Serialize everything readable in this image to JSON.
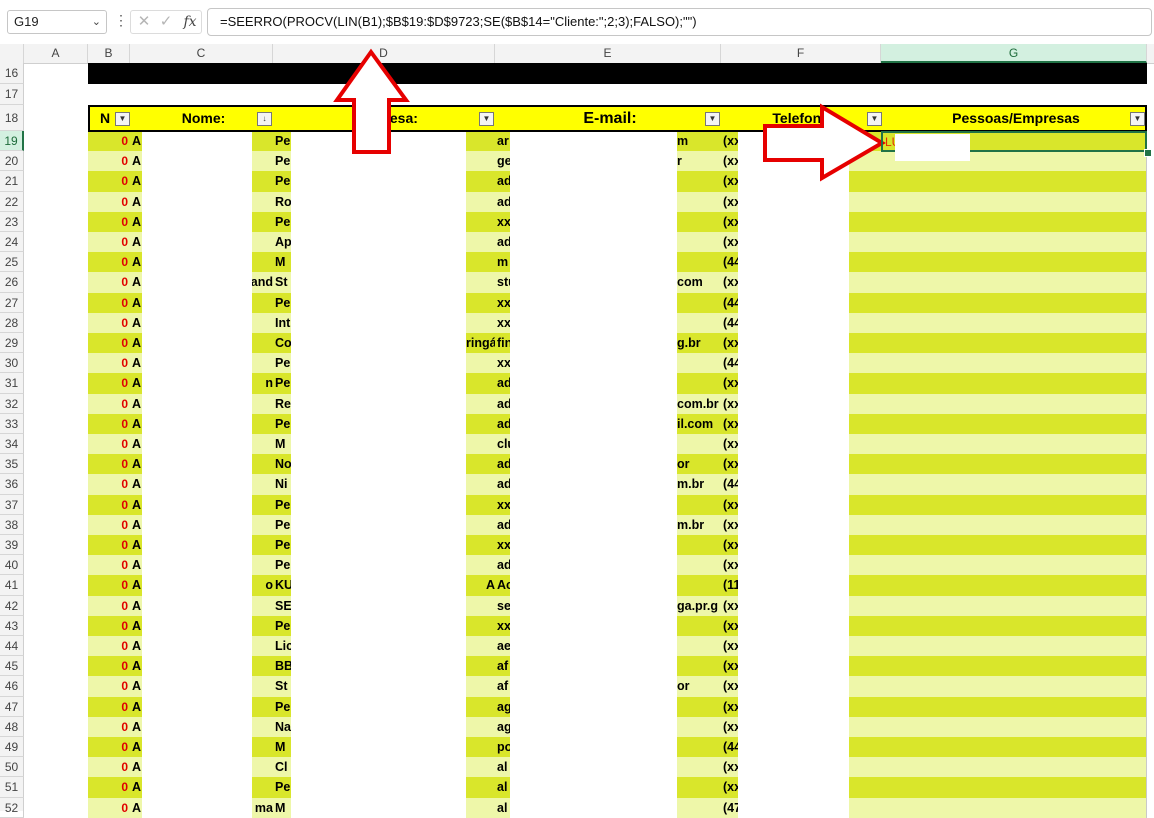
{
  "namebox": "G19",
  "formula_bar": {
    "fx_label": "fx",
    "cancel_glyph": "✕",
    "enter_glyph": "✓",
    "formula": "=SEERRO(PROCV(LIN(B1);$B$19:$D$9723;SE($B$14=\"Cliente:\";2;3);FALSO);\"\")"
  },
  "columns": [
    "A",
    "B",
    "C",
    "D",
    "E",
    "F",
    "G"
  ],
  "header": {
    "b": "N",
    "c": "Nome:",
    "d": "Empresa:",
    "e": "E-mail:",
    "f": "Telefone:",
    "g": "Pessoas/Empresas"
  },
  "row_numbers": [
    16,
    17,
    18,
    19,
    20,
    21,
    22,
    23,
    24,
    25,
    26,
    27,
    28,
    29,
    30,
    31,
    32,
    33,
    34,
    35,
    36,
    37,
    38,
    39,
    40,
    41,
    42,
    43,
    44,
    45,
    46,
    47,
    48,
    49,
    50,
    51,
    52
  ],
  "g19_value": "LU",
  "rows": [
    {
      "n": "0",
      "b": "A",
      "c2": "",
      "d": "Pe",
      "e": "ar",
      "e2": "m",
      "f": "(xx"
    },
    {
      "n": "0",
      "b": "A",
      "c2": "",
      "d": "Pe",
      "e": "ge",
      "e2": "r",
      "f": "(xx"
    },
    {
      "n": "0",
      "b": "A",
      "c2": "",
      "d": "Pe",
      "e": "ad",
      "e2": "",
      "f": "(xx"
    },
    {
      "n": "0",
      "b": "A",
      "c2": "",
      "d": "Ro",
      "e": "ad",
      "e2": "",
      "f": "(xx"
    },
    {
      "n": "0",
      "b": "A",
      "c2": "",
      "d": "Pe",
      "e": "xx",
      "e2": "",
      "f": "(xx"
    },
    {
      "n": "0",
      "b": "A",
      "c2": "",
      "d": "Ap",
      "e": "ad",
      "e2": "",
      "f": "(xx"
    },
    {
      "n": "0",
      "b": "A",
      "c2": "",
      "d": "M",
      "e": "m",
      "e2": "",
      "f": "(44"
    },
    {
      "n": "0",
      "b": "A",
      "c2": "and",
      "d": "St",
      "e": "stu",
      "e2": "com",
      "f": "(xx"
    },
    {
      "n": "0",
      "b": "A",
      "c2": "",
      "d": "Pe",
      "e": "xx",
      "e2": "",
      "f": "(44"
    },
    {
      "n": "0",
      "b": "A",
      "c2": "",
      "d": "Int",
      "e": "xx",
      "e2": "",
      "f": "(44"
    },
    {
      "n": "0",
      "b": "A",
      "c2": "",
      "d": "Co",
      "d2": "ringá",
      "e": "fin",
      "e2": "g.br",
      "f": "(xx"
    },
    {
      "n": "0",
      "b": "A",
      "c2": "",
      "d": "Pe",
      "e": "xx",
      "e2": "",
      "f": "(44"
    },
    {
      "n": "0",
      "b": "A",
      "c2": "n",
      "d": "Pe",
      "e": "ad",
      "e2": "",
      "f": "(xx"
    },
    {
      "n": "0",
      "b": "A",
      "c2": "",
      "d": "Re",
      "e": "ad",
      "e2": "com.br",
      "f": "(xx"
    },
    {
      "n": "0",
      "b": "A",
      "c2": "",
      "d": "Pe",
      "e": "ad",
      "e2": "il.com",
      "f": "(xx"
    },
    {
      "n": "0",
      "b": "A",
      "c2": "",
      "d": "M",
      "e": "clu",
      "e2": "",
      "f": "(xx"
    },
    {
      "n": "0",
      "b": "A",
      "c2": "",
      "d": "No",
      "e": "ad",
      "e2": "or",
      "f": "(xx"
    },
    {
      "n": "0",
      "b": "A",
      "c2": "",
      "d": "Ni",
      "e": "ad",
      "e2": "m.br",
      "f": "(44"
    },
    {
      "n": "0",
      "b": "A",
      "c2": "",
      "d": "Pe",
      "e": "xx",
      "e2": "",
      "f": "(xx"
    },
    {
      "n": "0",
      "b": "A",
      "c2": "",
      "d": "Pe",
      "e": "ad",
      "e2": "m.br",
      "f": "(xx"
    },
    {
      "n": "0",
      "b": "A",
      "c2": "",
      "d": "Pe",
      "e": "xx",
      "e2": "",
      "f": "(xx"
    },
    {
      "n": "0",
      "b": "A",
      "c2": "",
      "d": "Pe",
      "e": "ad",
      "e2": "",
      "f": "(xx"
    },
    {
      "n": "0",
      "b": "A",
      "c2": "o",
      "d": "KU",
      "d2": "A",
      "e": "Ac",
      "e2": "",
      "f": "(11"
    },
    {
      "n": "0",
      "b": "A",
      "c2": "",
      "d": "SE",
      "e": "se",
      "e2": "ga.pr.g",
      "f": "(xx"
    },
    {
      "n": "0",
      "b": "A",
      "c2": "",
      "d": "Pe",
      "e": "xx",
      "e2": "",
      "f": "(xx"
    },
    {
      "n": "0",
      "b": "A",
      "c2": "",
      "d": "Lic",
      "e": "ae",
      "e2": "",
      "f": "(xx"
    },
    {
      "n": "0",
      "b": "A",
      "c2": "",
      "d": "BB",
      "e": "af",
      "e2": "",
      "f": "(xx"
    },
    {
      "n": "0",
      "b": "A",
      "c2": "",
      "d": "St",
      "e": "af",
      "e2": "or",
      "f": "(xx"
    },
    {
      "n": "0",
      "b": "A",
      "c2": "",
      "d": "Pe",
      "e": "ag",
      "e2": "",
      "f": "(xx"
    },
    {
      "n": "0",
      "b": "A",
      "c2": "",
      "d": "Na",
      "e": "ag",
      "e2": "",
      "f": "(xx"
    },
    {
      "n": "0",
      "b": "A",
      "c2": "",
      "d": "M",
      "e": "po",
      "e2": "",
      "f": "(44"
    },
    {
      "n": "0",
      "b": "A",
      "c2": "",
      "d": "Cl",
      "e": "al",
      "e2": "",
      "f": "(xx"
    },
    {
      "n": "0",
      "b": "A",
      "c2": "",
      "d": "Pe",
      "e": "al",
      "e2": "",
      "f": "(xx"
    },
    {
      "n": "0",
      "b": "A",
      "c2": "ma",
      "d": "M",
      "e": "al",
      "e2": "",
      "f": "(47"
    }
  ],
  "colors": {
    "header_yellow": "#ffff00",
    "row_dark": "#d9e62b",
    "row_light": "#eef7a9",
    "error_red": "#e00000",
    "arrow_red": "#e60000",
    "selection_green": "#217346"
  }
}
